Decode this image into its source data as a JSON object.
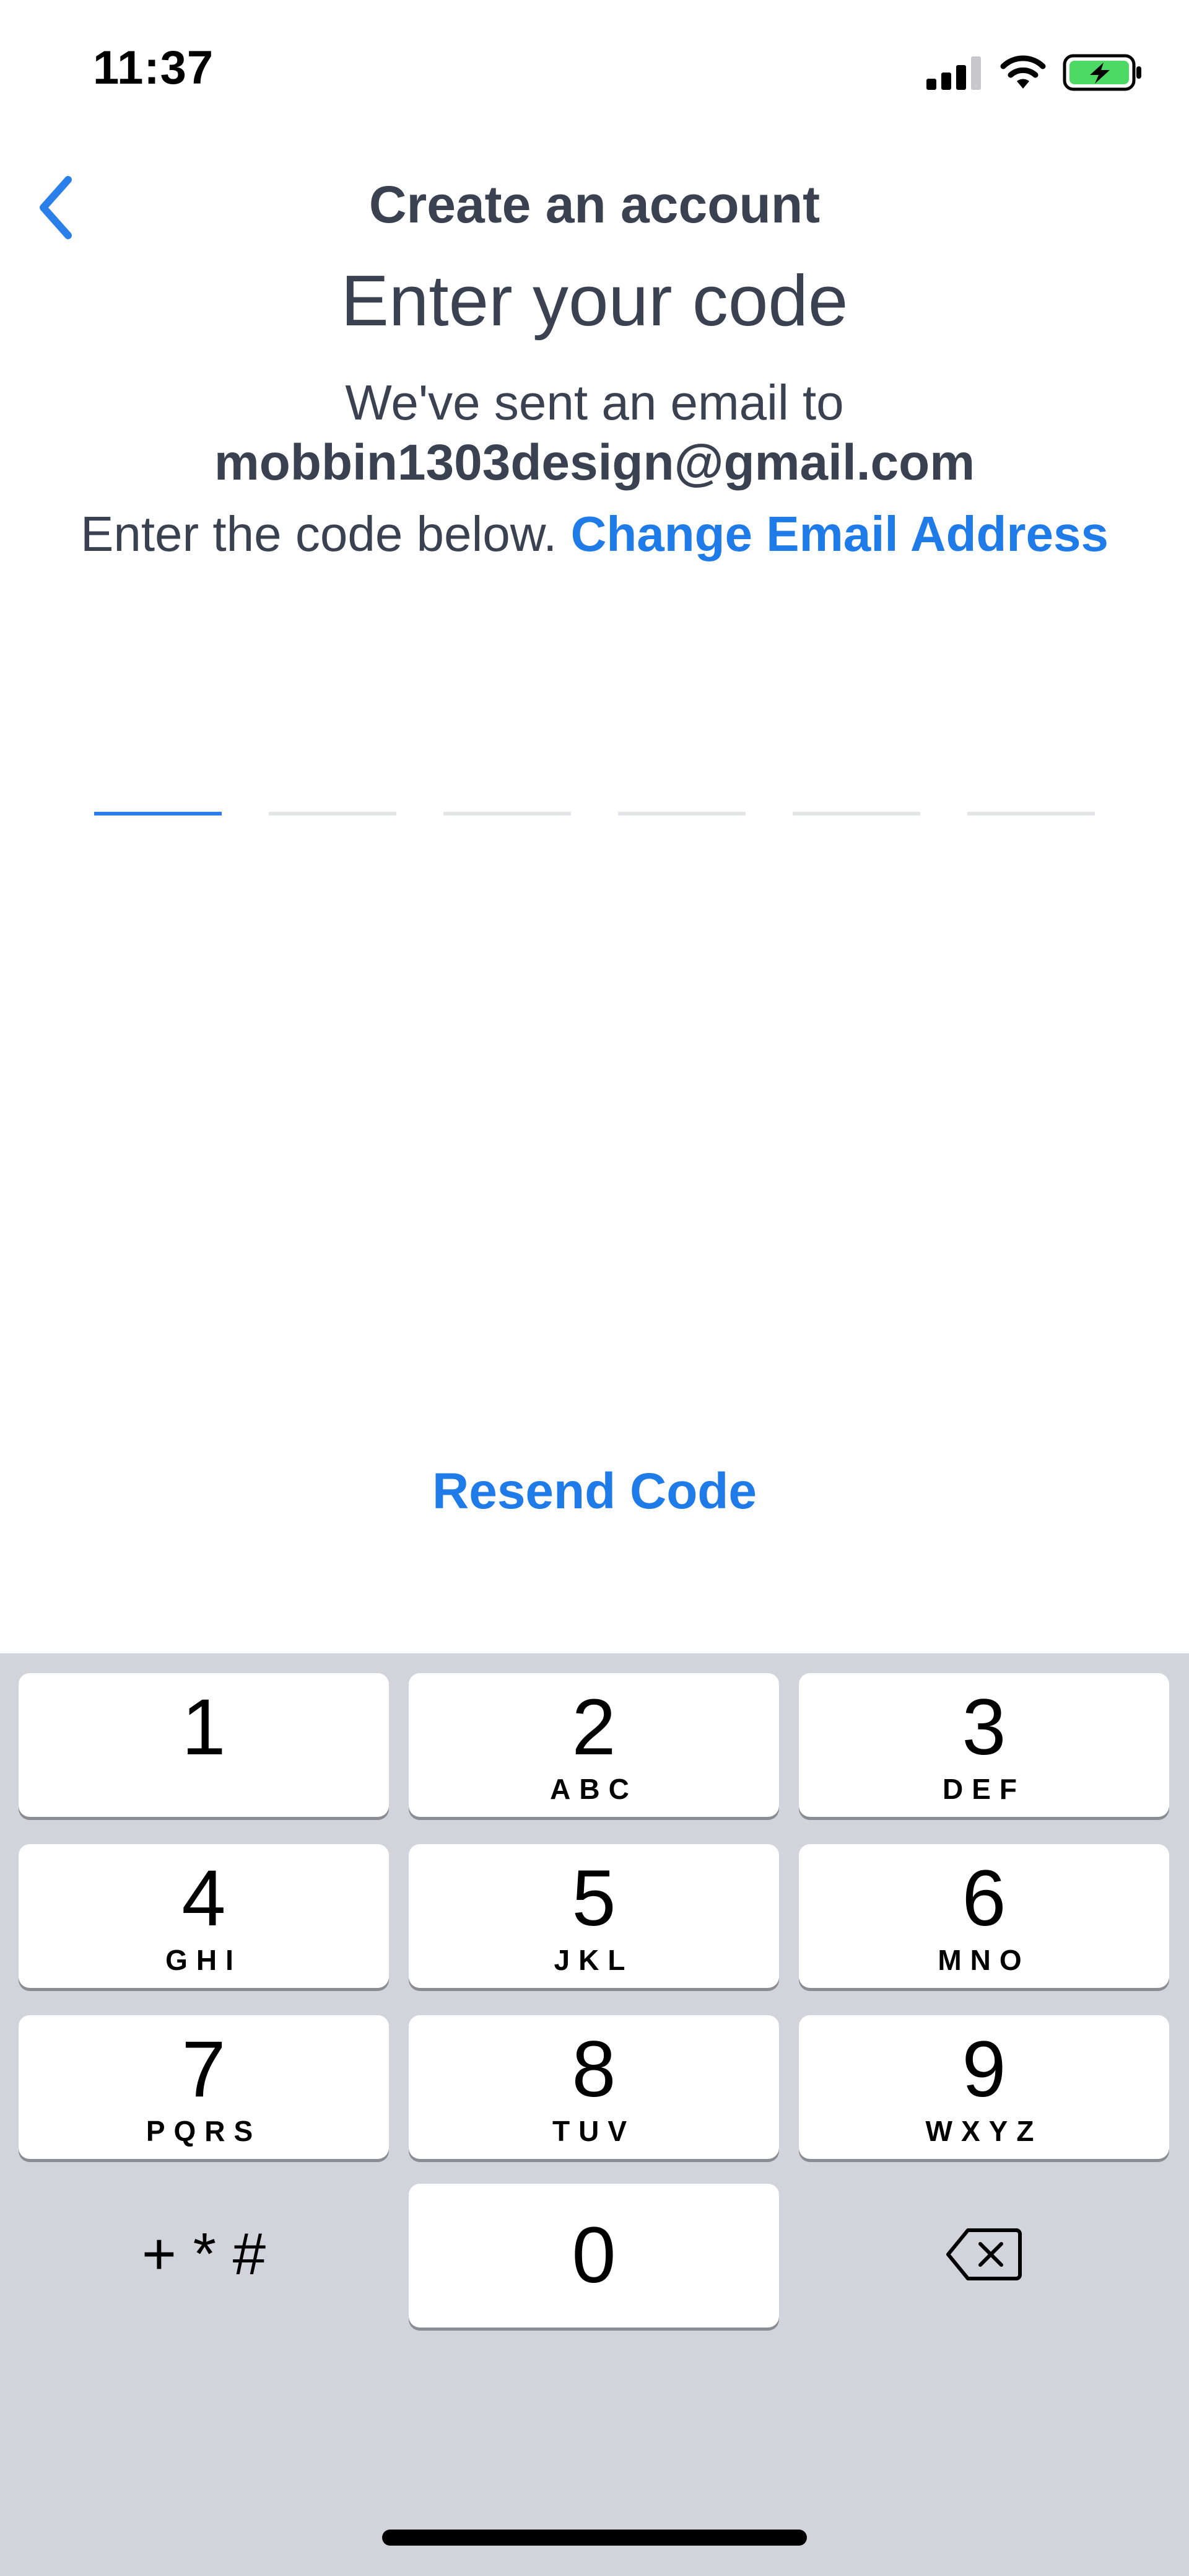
{
  "status_bar": {
    "time": "11:37",
    "icons": [
      "signal-icon",
      "wifi-icon",
      "battery-charging-icon"
    ],
    "battery_color": "#4cd964"
  },
  "nav": {
    "back_icon": "chevron-left-icon",
    "title": "Create an account"
  },
  "main": {
    "heading": "Enter your code",
    "sent_text": "We've sent an email to",
    "email": "mobbin1303design@gmail.com",
    "instruction": "Enter the code below.",
    "change_email_label": "Change Email Address",
    "code_length": 6,
    "active_slot": 1,
    "resend_label": "Resend Code"
  },
  "keypad": {
    "keys": [
      {
        "digit": "1",
        "letters": ""
      },
      {
        "digit": "2",
        "letters": "ABC"
      },
      {
        "digit": "3",
        "letters": "DEF"
      },
      {
        "digit": "4",
        "letters": "GHI"
      },
      {
        "digit": "5",
        "letters": "JKL"
      },
      {
        "digit": "6",
        "letters": "MNO"
      },
      {
        "digit": "7",
        "letters": "PQRS"
      },
      {
        "digit": "8",
        "letters": "TUV"
      },
      {
        "digit": "9",
        "letters": "WXYZ"
      },
      {
        "digit": "0",
        "letters": ""
      }
    ],
    "symbols_label": "+ * #",
    "delete_icon": "backspace-icon"
  },
  "colors": {
    "accent": "#1f7be8",
    "text": "#3a4150",
    "keypad_bg": "#d1d5db",
    "inactive_slot": "#e3e5e8"
  }
}
